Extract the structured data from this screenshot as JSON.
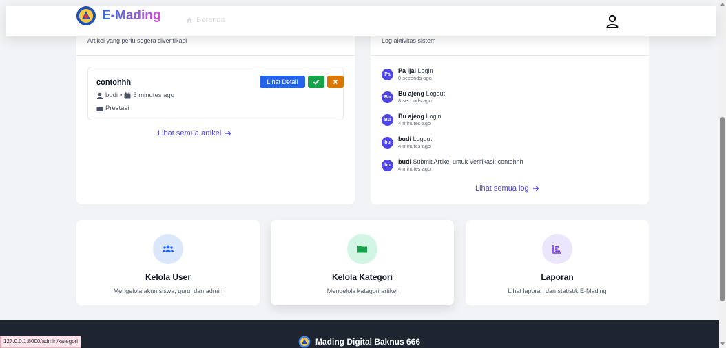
{
  "navbar": {
    "brand": "E-Mading",
    "home_label": "Beranda",
    "profile_icon": "user-icon"
  },
  "pending": {
    "subtitle": "Artikel yang perlu segera diverifikasi",
    "articles": [
      {
        "title": "contohhh",
        "author": "budi",
        "time": "5 minutes ago",
        "category": "Prestasi",
        "detail_label": "Lihat Detail"
      }
    ],
    "view_all": "Lihat semua artikel"
  },
  "activity": {
    "subtitle": "Log aktivitas sistem",
    "logs": [
      {
        "avatar": "Pa",
        "user": "Pa ijal",
        "action": "Login",
        "time": "0 seconds ago"
      },
      {
        "avatar": "Bu",
        "user": "Bu ajeng",
        "action": "Logout",
        "time": "8 seconds ago"
      },
      {
        "avatar": "Bu",
        "user": "Bu ajeng",
        "action": "Login",
        "time": "4 minutes ago"
      },
      {
        "avatar": "bu",
        "user": "budi",
        "action": "Logout",
        "time": "4 minutes ago"
      },
      {
        "avatar": "bu",
        "user": "budi",
        "action": "Submit Artikel untuk Verifikasi: contohhh",
        "time": "4 minutes ago"
      }
    ],
    "view_all": "Lihat semua log"
  },
  "features": [
    {
      "title": "Kelola User",
      "desc": "Mengelola akun siswa, guru, dan admin",
      "icon": "users-icon",
      "icon_bg": "#dbe7fb",
      "icon_color": "#2563eb"
    },
    {
      "title": "Kelola Kategori",
      "desc": "Mengelola kategori artikel",
      "icon": "folder-icon",
      "icon_bg": "#d3f5e4",
      "icon_color": "#16a34a"
    },
    {
      "title": "Laporan",
      "desc": "Lihat laporan dan statistik E-Mading",
      "icon": "chart-icon",
      "icon_bg": "#ece6fd",
      "icon_color": "#7c3aed"
    }
  ],
  "footer": {
    "brand": "Mading Digital Baknus 666"
  },
  "status_url": "127.0.0.1:8000/admin/kategori",
  "colors": {
    "primary": "#2563eb",
    "success": "#16a34a",
    "warning": "#d97706",
    "link": "#4f46e5",
    "footer_bg": "#1f2530"
  }
}
